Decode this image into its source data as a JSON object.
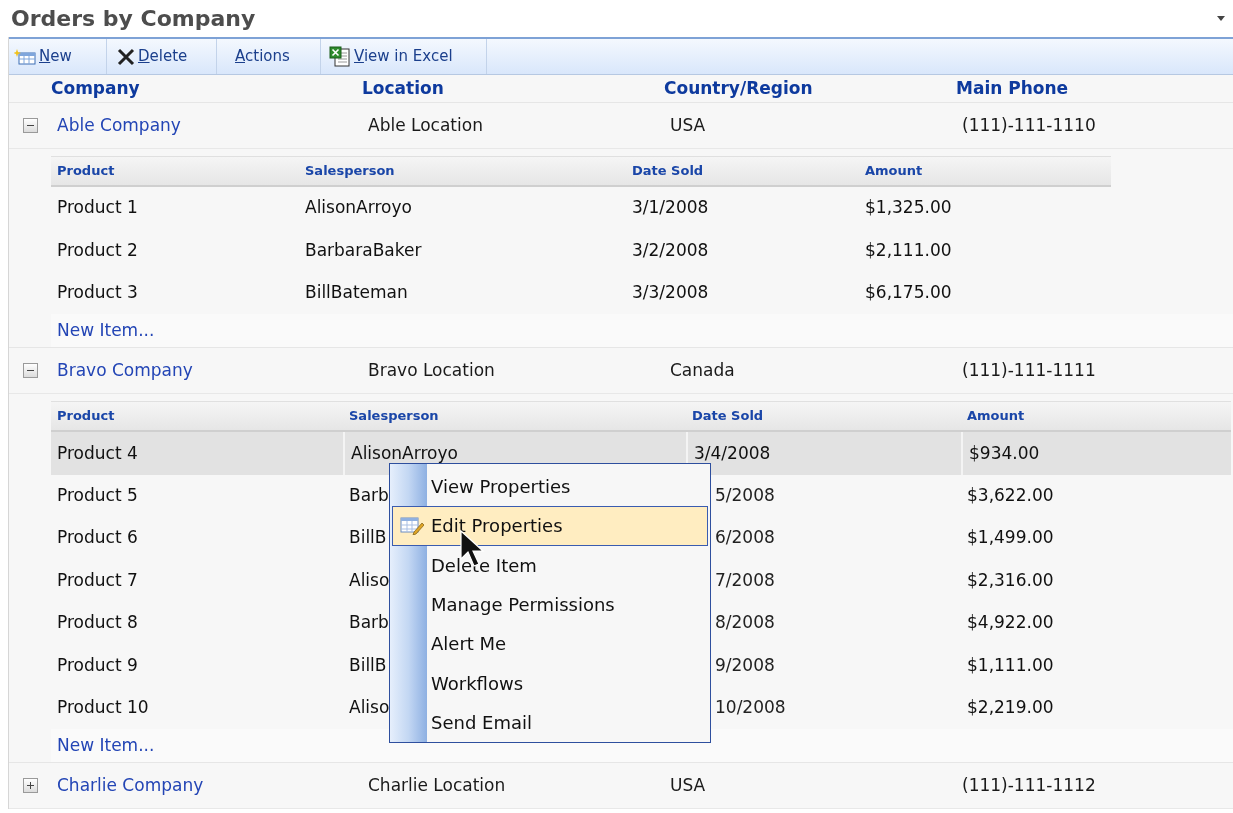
{
  "title": "Orders by Company",
  "toolbar": [
    {
      "label": "New",
      "kind": "new"
    },
    {
      "label": "Delete",
      "kind": "delete"
    },
    {
      "label": "Actions",
      "kind": "actions"
    },
    {
      "label": "View in Excel",
      "kind": "excel"
    }
  ],
  "columns": [
    "Company",
    "Location",
    "Country/Region",
    "Main Phone"
  ],
  "groups": [
    {
      "company": "Able Company",
      "location": "Able Location",
      "country": "USA",
      "phone": "(111)-111-1110",
      "expanded": true,
      "columns": [
        "Product",
        "Salesperson",
        "Date Sold",
        "Amount"
      ],
      "rows": [
        {
          "cells": [
            "Product 1",
            "AlisonArroyo",
            "3/1/2008",
            "$1,325.00"
          ],
          "selected": false,
          "under_menu": false
        },
        {
          "cells": [
            "Product 2",
            "BarbaraBaker",
            "3/2/2008",
            "$2,111.00"
          ],
          "selected": false,
          "under_menu": false
        },
        {
          "cells": [
            "Product 3",
            "BillBateman",
            "3/3/2008",
            "$6,175.00"
          ],
          "selected": false,
          "under_menu": false
        }
      ],
      "new_item": "New Item..."
    },
    {
      "company": "Bravo Company",
      "location": "Bravo Location",
      "country": "Canada",
      "phone": "(111)-111-1111",
      "expanded": true,
      "columns": [
        "Product",
        "Salesperson",
        "Date Sold",
        "Amount"
      ],
      "rows": [
        {
          "cells": [
            "Product 4",
            "AlisonArroyo",
            "3/4/2008",
            "$934.00"
          ],
          "selected": true,
          "under_menu": false
        },
        {
          "cells": [
            "Product 5",
            "Barb",
            "5/2008",
            "$3,622.00"
          ],
          "selected": false,
          "under_menu": true
        },
        {
          "cells": [
            "Product 6",
            "BillB",
            "6/2008",
            "$1,499.00"
          ],
          "selected": false,
          "under_menu": true
        },
        {
          "cells": [
            "Product 7",
            "Aliso",
            "7/2008",
            "$2,316.00"
          ],
          "selected": false,
          "under_menu": true
        },
        {
          "cells": [
            "Product 8",
            "Barb",
            "8/2008",
            "$4,922.00"
          ],
          "selected": false,
          "under_menu": true
        },
        {
          "cells": [
            "Product 9",
            "BillB",
            "9/2008",
            "$1,111.00"
          ],
          "selected": false,
          "under_menu": true
        },
        {
          "cells": [
            "Product 10",
            "Aliso",
            "10/2008",
            "$2,219.00"
          ],
          "selected": false,
          "under_menu": true
        }
      ],
      "new_item": "New Item..."
    },
    {
      "company": "Charlie Company",
      "location": "Charlie Location",
      "country": "USA",
      "phone": "(111)-111-1112",
      "expanded": false
    }
  ],
  "context_menu": {
    "items": [
      {
        "label": "View Properties",
        "selected": false,
        "kind": "plain"
      },
      {
        "label": "Edit Properties",
        "selected": true,
        "kind": "edit"
      },
      {
        "label": "Delete Item",
        "selected": false,
        "kind": "plain"
      },
      {
        "label": "Manage Permissions",
        "selected": false,
        "kind": "plain"
      },
      {
        "label": "Alert Me",
        "selected": false,
        "kind": "plain"
      },
      {
        "label": "Workflows",
        "selected": false,
        "kind": "plain"
      },
      {
        "label": "Send Email",
        "selected": false,
        "kind": "plain"
      }
    ]
  }
}
